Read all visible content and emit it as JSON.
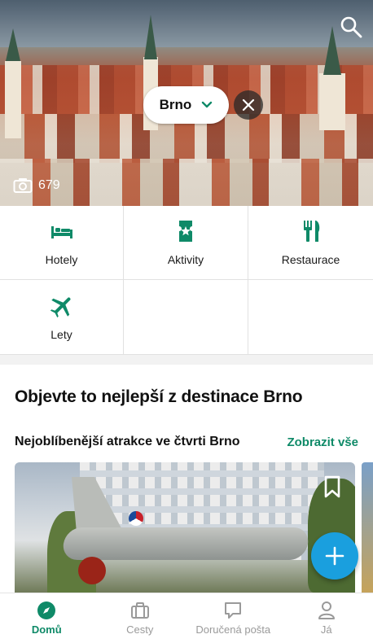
{
  "hero": {
    "city": "Brno",
    "photo_count": "679"
  },
  "categories": [
    {
      "label": "Hotely",
      "icon": "bed-icon"
    },
    {
      "label": "Aktivity",
      "icon": "ticket-icon"
    },
    {
      "label": "Restaurace",
      "icon": "fork-knife-icon"
    },
    {
      "label": "Lety",
      "icon": "airplane-icon"
    }
  ],
  "section": {
    "title": "Objevte to nejlepší z destinace Brno",
    "subtitle": "Nejoblíbenější atrakce ve čtvrti Brno",
    "see_all": "Zobrazit vše"
  },
  "nav": {
    "items": [
      {
        "label": "Domů",
        "active": true
      },
      {
        "label": "Cesty",
        "active": false
      },
      {
        "label": "Doručená pošta",
        "active": false
      },
      {
        "label": "Já",
        "active": false
      }
    ]
  },
  "colors": {
    "accent": "#0f8a68",
    "fab": "#1a9fde"
  }
}
